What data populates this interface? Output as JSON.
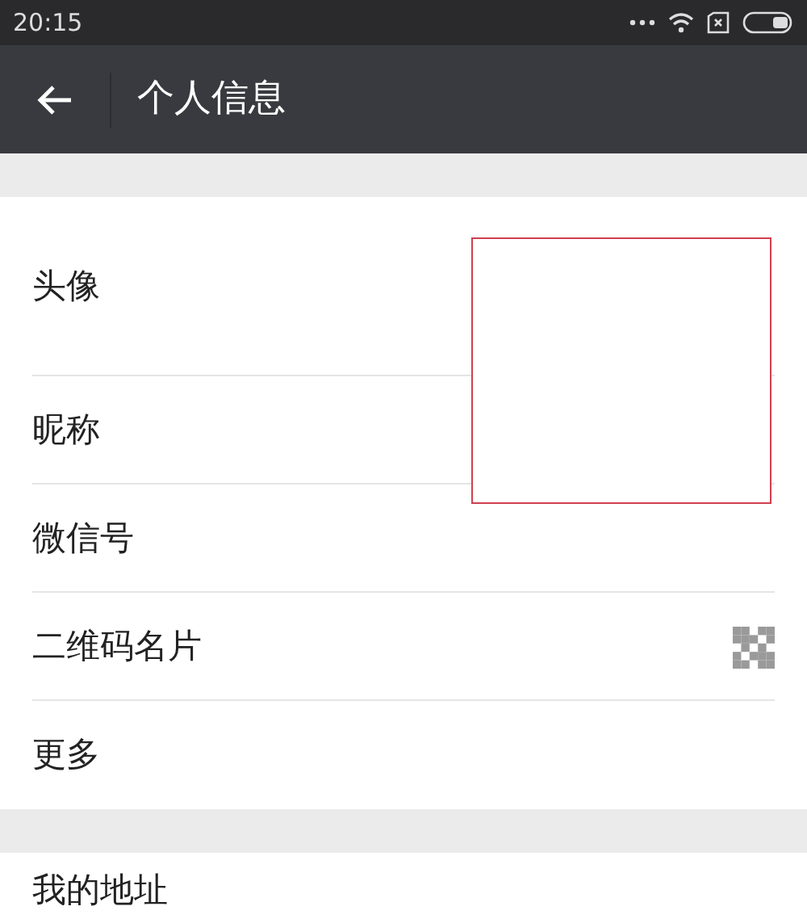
{
  "status_bar": {
    "time": "20:15"
  },
  "header": {
    "title": "个人信息"
  },
  "sections": [
    {
      "items": [
        {
          "label": "头像",
          "kind": "avatar"
        },
        {
          "label": "昵称",
          "kind": "plain"
        },
        {
          "label": "微信号",
          "kind": "plain"
        },
        {
          "label": "二维码名片",
          "kind": "qr"
        },
        {
          "label": "更多",
          "kind": "plain"
        }
      ]
    },
    {
      "items": [
        {
          "label": "我的地址",
          "kind": "plain"
        }
      ]
    }
  ]
}
